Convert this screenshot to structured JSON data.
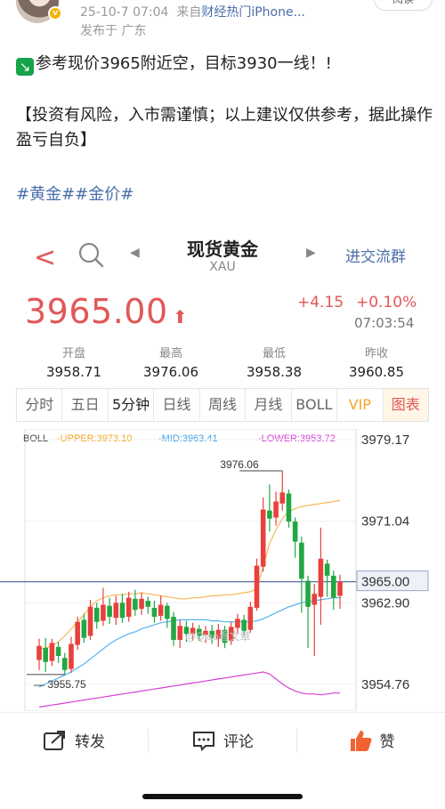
{
  "post": {
    "meta_time": "25-10-7 07:04",
    "meta_from": "来自",
    "meta_source": "财经热门iPhone...",
    "location": "发布于 广东",
    "follow_label": "阅读",
    "line1": "参考现价3965附近空，目标3930一线！!",
    "line2": "【投资有风险，入市需谨慎；以上建议仅供参考，据此操作盈亏自负】",
    "tags": "#黄金##金价#"
  },
  "quote": {
    "title": "现货黄金",
    "code": "XAU",
    "group_label": "进交流群",
    "price": "3965.00",
    "change": "+4.15",
    "change_pct": "+0.10%",
    "time": "07:03:54",
    "stats": [
      {
        "label": "开盘",
        "value": "3958.71"
      },
      {
        "label": "最高",
        "value": "3976.06"
      },
      {
        "label": "最低",
        "value": "3958.38"
      },
      {
        "label": "昨收",
        "value": "3960.85"
      }
    ],
    "tabs": [
      "分时",
      "五日",
      "5分钟",
      "日线",
      "周线",
      "月线",
      "BOLL",
      "VIP",
      "图表"
    ]
  },
  "chart_data": {
    "type": "candlestick",
    "indicator_labels": {
      "boll": "BOLL",
      "upper": "·UPPER:3973.10",
      "mid": "·MID:3963.41",
      "lower": "·LOWER:3953.72"
    },
    "y_ticks": [
      "3979.17",
      "3971.04",
      "3965.00",
      "3962.90",
      "3954.76"
    ],
    "ylim": [
      3954.0,
      3980.0
    ],
    "high_label": "3976.06",
    "low_label": "3955.75",
    "current_price_line": 3965.0,
    "watermark": "@Qiao看文章",
    "candles": [
      [
        3957.2,
        3958.6,
        3956.2,
        3959.3
      ],
      [
        3958.4,
        3957.0,
        3956.0,
        3959.4
      ],
      [
        3957.1,
        3958.9,
        3956.6,
        3959.3
      ],
      [
        3958.5,
        3957.6,
        3956.9,
        3959.0
      ],
      [
        3957.4,
        3956.2,
        3955.75,
        3957.9
      ],
      [
        3956.3,
        3958.8,
        3955.9,
        3959.5
      ],
      [
        3958.7,
        3961.0,
        3958.2,
        3961.5
      ],
      [
        3961.2,
        3959.4,
        3958.9,
        3961.8
      ],
      [
        3959.6,
        3962.5,
        3959.2,
        3963.2
      ],
      [
        3962.4,
        3961.0,
        3960.3,
        3962.9
      ],
      [
        3961.1,
        3962.7,
        3960.6,
        3964.4
      ],
      [
        3962.6,
        3961.5,
        3960.8,
        3963.4
      ],
      [
        3961.4,
        3962.9,
        3960.7,
        3963.6
      ],
      [
        3962.9,
        3961.4,
        3960.9,
        3963.8
      ],
      [
        3961.5,
        3963.4,
        3961.0,
        3964.0
      ],
      [
        3963.3,
        3962.2,
        3961.6,
        3964.2
      ],
      [
        3962.3,
        3963.3,
        3961.7,
        3963.9
      ],
      [
        3963.1,
        3962.5,
        3961.8,
        3963.5
      ],
      [
        3962.4,
        3961.5,
        3960.9,
        3963.1
      ],
      [
        3961.6,
        3962.7,
        3961.1,
        3963.6
      ],
      [
        3962.6,
        3961.3,
        3960.4,
        3962.9
      ],
      [
        3961.5,
        3959.2,
        3958.6,
        3962.0
      ],
      [
        3959.2,
        3960.6,
        3958.4,
        3961.2
      ],
      [
        3960.5,
        3959.8,
        3959.0,
        3961.1
      ],
      [
        3959.8,
        3960.4,
        3959.1,
        3960.9
      ],
      [
        3960.3,
        3959.6,
        3959.1,
        3960.7
      ],
      [
        3959.7,
        3960.1,
        3958.9,
        3960.6
      ],
      [
        3960.1,
        3959.4,
        3958.8,
        3960.7
      ],
      [
        3959.3,
        3960.2,
        3958.5,
        3960.8
      ],
      [
        3960.2,
        3958.9,
        3958.38,
        3960.6
      ],
      [
        3959.1,
        3960.5,
        3958.7,
        3961.0
      ],
      [
        3960.4,
        3961.3,
        3959.9,
        3961.8
      ],
      [
        3961.2,
        3960.1,
        3959.6,
        3961.7
      ],
      [
        3960.2,
        3962.5,
        3959.9,
        3963.0
      ],
      [
        3962.4,
        3966.6,
        3962.1,
        3967.3
      ],
      [
        3966.5,
        3972.2,
        3966.0,
        3973.4
      ],
      [
        3972.1,
        3971.3,
        3970.0,
        3974.7
      ],
      [
        3971.4,
        3973.0,
        3970.6,
        3974.0
      ],
      [
        3972.8,
        3973.9,
        3972.1,
        3976.06
      ],
      [
        3973.8,
        3971.0,
        3970.4,
        3974.2
      ],
      [
        3971.0,
        3969.0,
        3967.4,
        3971.4
      ],
      [
        3968.9,
        3965.3,
        3961.9,
        3969.5
      ],
      [
        3965.1,
        3962.5,
        3958.4,
        3965.6
      ],
      [
        3962.7,
        3963.8,
        3957.6,
        3964.8
      ],
      [
        3963.5,
        3967.3,
        3960.7,
        3970.4
      ],
      [
        3966.8,
        3965.6,
        3963.5,
        3967.2
      ],
      [
        3965.6,
        3963.4,
        3962.2,
        3966.1
      ],
      [
        3963.6,
        3965.0,
        3962.3,
        3965.7
      ]
    ],
    "upper": [
      3958.3,
      3958.4,
      3958.6,
      3959.0,
      3959.6,
      3960.3,
      3961.0,
      3961.7,
      3962.5,
      3963.1,
      3963.4,
      3963.6,
      3963.7,
      3963.7,
      3963.8,
      3963.8,
      3963.9,
      3963.8,
      3963.7,
      3963.6,
      3963.5,
      3963.4,
      3963.3,
      3963.3,
      3963.4,
      3963.4,
      3963.5,
      3963.6,
      3963.6,
      3963.7,
      3963.7,
      3963.8,
      3963.9,
      3964.0,
      3964.3,
      3966.5,
      3968.8,
      3970.2,
      3971.3,
      3972.0,
      3972.3,
      3972.5,
      3972.6,
      3972.7,
      3972.8,
      3972.9,
      3973.0,
      3973.1
    ],
    "mid": [
      3954.5,
      3954.8,
      3955.1,
      3955.4,
      3955.7,
      3956.0,
      3956.4,
      3956.8,
      3957.3,
      3957.8,
      3958.3,
      3958.8,
      3959.2,
      3959.5,
      3959.8,
      3960.0,
      3960.3,
      3960.5,
      3960.7,
      3960.9,
      3961.0,
      3961.1,
      3961.2,
      3961.2,
      3961.2,
      3961.2,
      3961.2,
      3961.1,
      3961.1,
      3961.0,
      3961.0,
      3961.0,
      3961.0,
      3961.0,
      3961.1,
      3961.3,
      3961.6,
      3961.9,
      3962.2,
      3962.5,
      3962.7,
      3962.9,
      3963.0,
      3963.1,
      3963.2,
      3963.3,
      3963.4,
      3963.41
    ],
    "lower": [
      3952.5,
      3952.6,
      3952.7,
      3952.8,
      3952.9,
      3953.0,
      3953.1,
      3953.2,
      3953.3,
      3953.4,
      3953.5,
      3953.6,
      3953.7,
      3953.8,
      3953.9,
      3954.0,
      3954.1,
      3954.2,
      3954.3,
      3954.4,
      3954.5,
      3954.6,
      3954.7,
      3954.8,
      3954.9,
      3955.0,
      3955.1,
      3955.2,
      3955.3,
      3955.4,
      3955.5,
      3955.6,
      3955.7,
      3955.8,
      3955.9,
      3956.0,
      3955.8,
      3955.3,
      3954.8,
      3954.4,
      3954.1,
      3953.9,
      3953.8,
      3953.8,
      3953.72,
      3953.8,
      3953.9,
      3953.9
    ]
  },
  "actions": {
    "share": "转发",
    "comment": "评论",
    "like": "赞"
  }
}
